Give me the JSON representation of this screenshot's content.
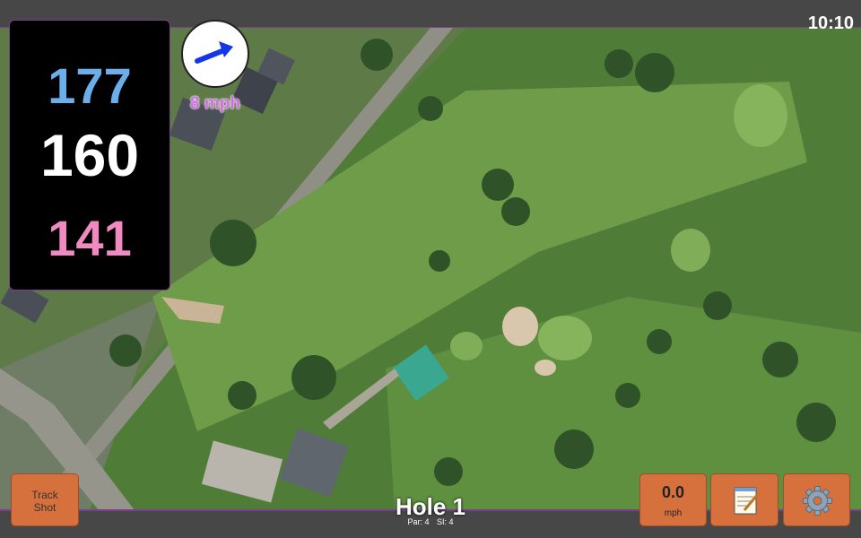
{
  "status": {
    "time": "10:10"
  },
  "distances": {
    "back": "177",
    "middle": "160",
    "front": "141"
  },
  "wind": {
    "speed_label": "8 mph",
    "arrow_icon": "wind-arrow-icon"
  },
  "buttons": {
    "track_shot_line1": "Track",
    "track_shot_line2": "Shot",
    "speed_value": "0.0",
    "speed_unit": "mph",
    "notes_icon": "notepad-icon",
    "settings_icon": "gear-icon"
  },
  "hole": {
    "title": "Hole 1",
    "par_label": "Par: 4",
    "si_label": "SI: 4"
  },
  "colors": {
    "back": "#6aaeea",
    "middle": "#ffffff",
    "front": "#f28ac2",
    "wind_text": "#d26de6",
    "button": "#d6703d",
    "bar_border": "#7a3f8f"
  }
}
